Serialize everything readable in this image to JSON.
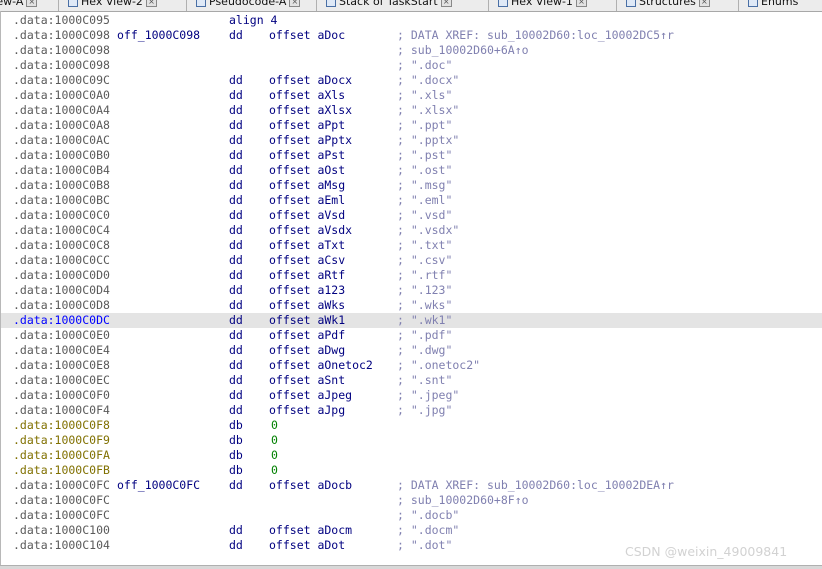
{
  "tabs": [
    {
      "label": "View-A",
      "icon": "listing-icon"
    },
    {
      "label": "Hex View-2",
      "icon": "hex-view-icon"
    },
    {
      "label": "Pseudocode-A",
      "icon": "pseudocode-icon"
    },
    {
      "label": "Stack of TaskStart",
      "icon": "stack-icon"
    },
    {
      "label": "Hex View-1",
      "icon": "hex-view-icon"
    },
    {
      "label": "Structures",
      "icon": "structures-icon"
    },
    {
      "label": "Enums",
      "icon": "enums-icon"
    }
  ],
  "listing": [
    {
      "addr": ".data:1000C095",
      "label": "",
      "mnem": "align 4",
      "op": "",
      "cmt": ""
    },
    {
      "addr": ".data:1000C098",
      "label": "off_1000C098",
      "mnem": "dd",
      "op": "offset aDoc",
      "cmt": "; DATA XREF: sub_10002D60:loc_10002DC5↑r"
    },
    {
      "addr": ".data:1000C098",
      "label": "",
      "mnem": "",
      "op": "",
      "cmt": "; sub_10002D60+6A↑o"
    },
    {
      "addr": ".data:1000C098",
      "label": "",
      "mnem": "",
      "op": "",
      "cmt": "; \".doc\""
    },
    {
      "addr": ".data:1000C09C",
      "label": "",
      "mnem": "dd",
      "op": "offset aDocx",
      "cmt": "; \".docx\""
    },
    {
      "addr": ".data:1000C0A0",
      "label": "",
      "mnem": "dd",
      "op": "offset aXls",
      "cmt": "; \".xls\""
    },
    {
      "addr": ".data:1000C0A4",
      "label": "",
      "mnem": "dd",
      "op": "offset aXlsx",
      "cmt": "; \".xlsx\""
    },
    {
      "addr": ".data:1000C0A8",
      "label": "",
      "mnem": "dd",
      "op": "offset aPpt",
      "cmt": "; \".ppt\""
    },
    {
      "addr": ".data:1000C0AC",
      "label": "",
      "mnem": "dd",
      "op": "offset aPptx",
      "cmt": "; \".pptx\""
    },
    {
      "addr": ".data:1000C0B0",
      "label": "",
      "mnem": "dd",
      "op": "offset aPst",
      "cmt": "; \".pst\""
    },
    {
      "addr": ".data:1000C0B4",
      "label": "",
      "mnem": "dd",
      "op": "offset aOst",
      "cmt": "; \".ost\""
    },
    {
      "addr": ".data:1000C0B8",
      "label": "",
      "mnem": "dd",
      "op": "offset aMsg",
      "cmt": "; \".msg\""
    },
    {
      "addr": ".data:1000C0BC",
      "label": "",
      "mnem": "dd",
      "op": "offset aEml",
      "cmt": "; \".eml\""
    },
    {
      "addr": ".data:1000C0C0",
      "label": "",
      "mnem": "dd",
      "op": "offset aVsd",
      "cmt": "; \".vsd\""
    },
    {
      "addr": ".data:1000C0C4",
      "label": "",
      "mnem": "dd",
      "op": "offset aVsdx",
      "cmt": "; \".vsdx\""
    },
    {
      "addr": ".data:1000C0C8",
      "label": "",
      "mnem": "dd",
      "op": "offset aTxt",
      "cmt": "; \".txt\""
    },
    {
      "addr": ".data:1000C0CC",
      "label": "",
      "mnem": "dd",
      "op": "offset aCsv",
      "cmt": "; \".csv\""
    },
    {
      "addr": ".data:1000C0D0",
      "label": "",
      "mnem": "dd",
      "op": "offset aRtf",
      "cmt": "; \".rtf\""
    },
    {
      "addr": ".data:1000C0D4",
      "label": "",
      "mnem": "dd",
      "op": "offset a123",
      "cmt": "; \".123\""
    },
    {
      "addr": ".data:1000C0D8",
      "label": "",
      "mnem": "dd",
      "op": "offset aWks",
      "cmt": "; \".wks\""
    },
    {
      "addr": ".data:1000C0DC",
      "label": "",
      "mnem": "dd",
      "op": "offset aWk1",
      "cmt": "; \".wk1\"",
      "highlighted": true
    },
    {
      "addr": ".data:1000C0E0",
      "label": "",
      "mnem": "dd",
      "op": "offset aPdf",
      "cmt": "; \".pdf\""
    },
    {
      "addr": ".data:1000C0E4",
      "label": "",
      "mnem": "dd",
      "op": "offset aDwg",
      "cmt": "; \".dwg\""
    },
    {
      "addr": ".data:1000C0E8",
      "label": "",
      "mnem": "dd",
      "op": "offset aOnetoc2",
      "cmt": "; \".onetoc2\""
    },
    {
      "addr": ".data:1000C0EC",
      "label": "",
      "mnem": "dd",
      "op": "offset aSnt",
      "cmt": "; \".snt\""
    },
    {
      "addr": ".data:1000C0F0",
      "label": "",
      "mnem": "dd",
      "op": "offset aJpeg",
      "cmt": "; \".jpeg\""
    },
    {
      "addr": ".data:1000C0F4",
      "label": "",
      "mnem": "dd",
      "op": "offset aJpg",
      "cmt": "; \".jpg\""
    },
    {
      "addr": ".data:1000C0F8",
      "label": "",
      "mnem": "db",
      "op": "0",
      "cmt": "",
      "unexplored": true
    },
    {
      "addr": ".data:1000C0F9",
      "label": "",
      "mnem": "db",
      "op": "0",
      "cmt": "",
      "unexplored": true
    },
    {
      "addr": ".data:1000C0FA",
      "label": "",
      "mnem": "db",
      "op": "0",
      "cmt": "",
      "unexplored": true
    },
    {
      "addr": ".data:1000C0FB",
      "label": "",
      "mnem": "db",
      "op": "0",
      "cmt": "",
      "unexplored": true
    },
    {
      "addr": ".data:1000C0FC",
      "label": "off_1000C0FC",
      "mnem": "dd",
      "op": "offset aDocb",
      "cmt": "; DATA XREF: sub_10002D60:loc_10002DEA↑r"
    },
    {
      "addr": ".data:1000C0FC",
      "label": "",
      "mnem": "",
      "op": "",
      "cmt": "; sub_10002D60+8F↑o"
    },
    {
      "addr": ".data:1000C0FC",
      "label": "",
      "mnem": "",
      "op": "",
      "cmt": "; \".docb\""
    },
    {
      "addr": ".data:1000C100",
      "label": "",
      "mnem": "dd",
      "op": "offset aDocm",
      "cmt": "; \".docm\""
    },
    {
      "addr": ".data:1000C104",
      "label": "",
      "mnem": "dd",
      "op": "offset aDot",
      "cmt": "; \".dot\""
    }
  ],
  "watermark": "CSDN @weixin_49009841",
  "colors": {
    "address": "#5a5a5a",
    "selected_address": "#0000ff",
    "unexplored_address": "#807000",
    "code": "#000080",
    "number": "#008000",
    "comment": "#8080b0",
    "highlight_row": "#e4e4e4"
  }
}
